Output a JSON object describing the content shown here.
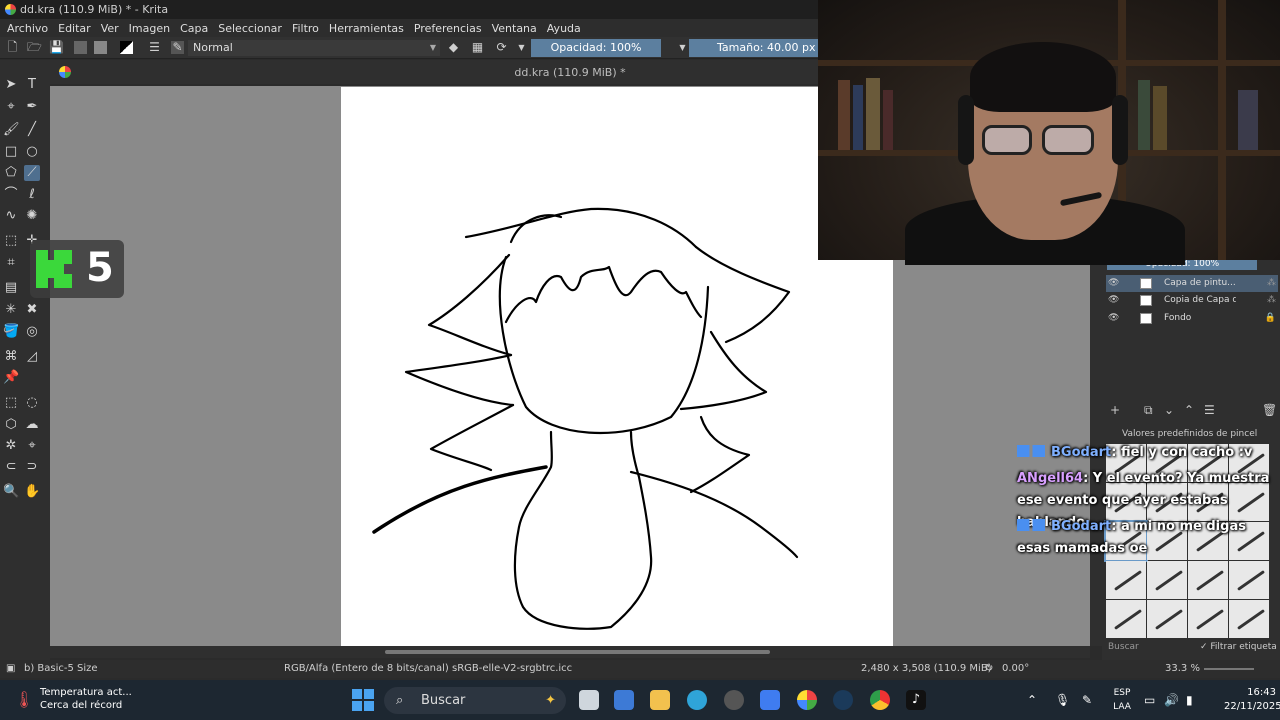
{
  "window": {
    "title": "dd.kra (110.9 MiB) * - Krita"
  },
  "menubar": {
    "items": [
      "Archivo",
      "Editar",
      "Ver",
      "Imagen",
      "Capa",
      "Seleccionar",
      "Filtro",
      "Herramientas",
      "Preferencias",
      "Ventana",
      "Ayuda"
    ]
  },
  "toolbar": {
    "blend_mode": "Normal",
    "opacity_label": "Opacidad: 100%",
    "size_label": "Tamaño: 40.00 px"
  },
  "document": {
    "tab_title": "dd.kra (110.9 MiB) *"
  },
  "layers": {
    "opacity_label": "Opacidad:  100%",
    "items": [
      {
        "name": "Capa de pintu...",
        "active": true
      },
      {
        "name": "Copia de Capa d...",
        "active": false
      },
      {
        "name": "Fondo",
        "active": false
      }
    ]
  },
  "brush_presets": {
    "title": "Valores predefinidos de pincel",
    "search_placeholder": "Buscar",
    "filter_label": "Filtrar etiqueta"
  },
  "overlay": {
    "badge_number": "5"
  },
  "chat": [
    {
      "user": "BGodart",
      "message": ": fiel y con cacho :v",
      "user_color": "#7fb0ff"
    },
    {
      "user": "ANgell64",
      "message": ": Y el evento? Ya muestra ese evento que ayer estabas hablando",
      "user_color": "#d8a0ff"
    },
    {
      "user": "BGodart",
      "message": ": a mi no me digas esas mamadas oe",
      "user_color": "#7fb0ff"
    }
  ],
  "statusbar": {
    "brush_name": "b) Basic-5 Size",
    "color_info": "RGB/Alfa (Entero de 8 bits/canal)  sRGB-elle-V2-srgbtrc.icc",
    "dimensions": "2,480 x 3,508 (110.9 MiB)",
    "rotation": "0.00°",
    "zoom": "33.3 %"
  },
  "taskbar": {
    "weather_title": "Temperatura act...",
    "weather_sub": "Cerca del récord",
    "search_label": "Buscar",
    "lang_line1": "ESP",
    "lang_line2": "LAA",
    "time": "16:43",
    "date": "22/11/2025"
  },
  "colors": {
    "accent": "#5c7f9f",
    "canvas_bg": "#8a8a8a",
    "taskbar": "#1d2731"
  }
}
